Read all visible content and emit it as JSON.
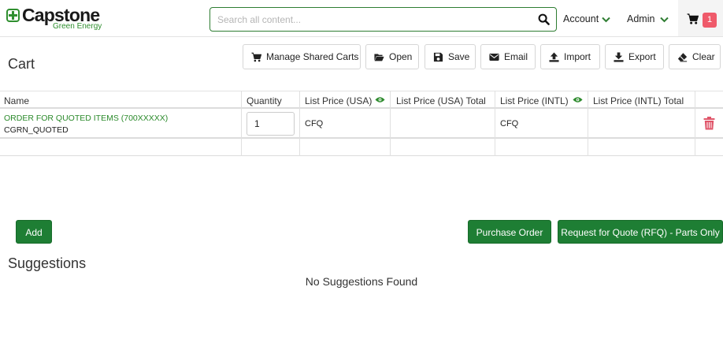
{
  "brand": {
    "name": "Capstone",
    "tagline": "Green Energy"
  },
  "search": {
    "placeholder": "Search all content...",
    "value": ""
  },
  "nav": {
    "account_label": "Account",
    "admin_label": "Admin",
    "cart_count": "1"
  },
  "page": {
    "title": "Cart"
  },
  "toolbar": {
    "manage_shared_carts": "Manage Shared Carts",
    "open": "Open",
    "save": "Save",
    "email": "Email",
    "import": "Import",
    "export": "Export",
    "clear": "Clear"
  },
  "table": {
    "columns": [
      "Name",
      "Quantity",
      "List Price (USA)",
      "List Price (USA) Total",
      "List Price (INTL)",
      "List Price (INTL) Total"
    ],
    "rows": [
      {
        "name": "ORDER FOR QUOTED ITEMS (700XXXXX)",
        "part_number": "CGRN_QUOTED",
        "quantity": "1",
        "list_price_usa": "CFQ",
        "list_price_usa_total": "",
        "list_price_intl": "CFQ",
        "list_price_intl_total": ""
      }
    ]
  },
  "actions": {
    "add": "Add",
    "purchase_order": "Purchase Order",
    "rfq": "Request for Quote (RFQ) - Parts Only"
  },
  "suggestions": {
    "title": "Suggestions",
    "empty_message": "No Suggestions Found"
  },
  "colors": {
    "brand_green": "#2f8f2f",
    "button_green": "#1e7e34",
    "badge": "#ef5a6a",
    "delete": "#e0566a"
  }
}
